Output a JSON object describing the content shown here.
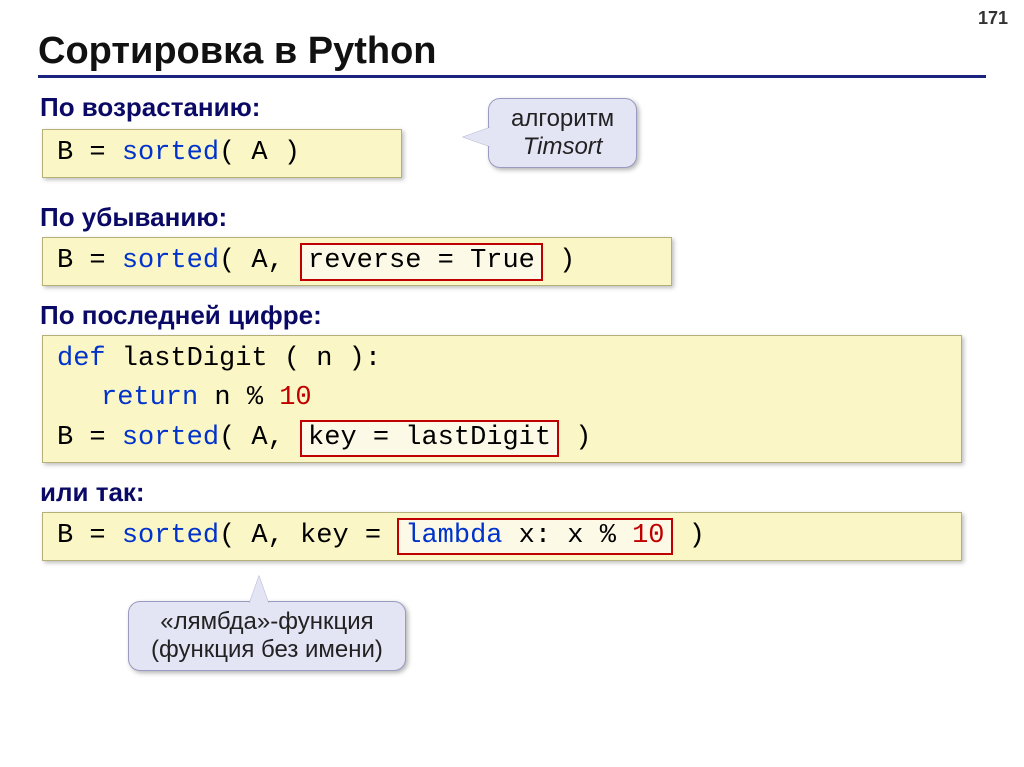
{
  "page_number": "171",
  "title": "Сортировка в Python",
  "section1_label": "По возрастанию:",
  "code1": {
    "b_eq": "B = ",
    "sorted": "sorted",
    "paren_open": "( A )"
  },
  "callout1": {
    "line1": "алгоритм",
    "line2": "Timsort"
  },
  "section2_label": "По убыванию:",
  "code2": {
    "b_eq": "B = ",
    "sorted": "sorted",
    "a_comma": "( A, ",
    "highlight": "reverse = True",
    "close": " )"
  },
  "section3_label": "По последней цифре:",
  "code3": {
    "def_kw": "def",
    "func_sig": " lastDigit ( n ):",
    "return_kw": "return",
    "expr_pre": " n % ",
    "ten": "10",
    "b_eq": "B = ",
    "sorted": "sorted",
    "a_comma": "( A, ",
    "highlight": "key = lastDigit",
    "close": " )"
  },
  "section4_label": "или так:",
  "code4": {
    "b_eq": "B = ",
    "sorted": "sorted",
    "a_key": "( A, key = ",
    "highlight_pre": "lambda",
    "highlight_mid": " x: x % ",
    "highlight_num": "10",
    "close": " )"
  },
  "callout2": {
    "line1": "«лямбда»-функция",
    "line2": "(функция без имени)"
  }
}
